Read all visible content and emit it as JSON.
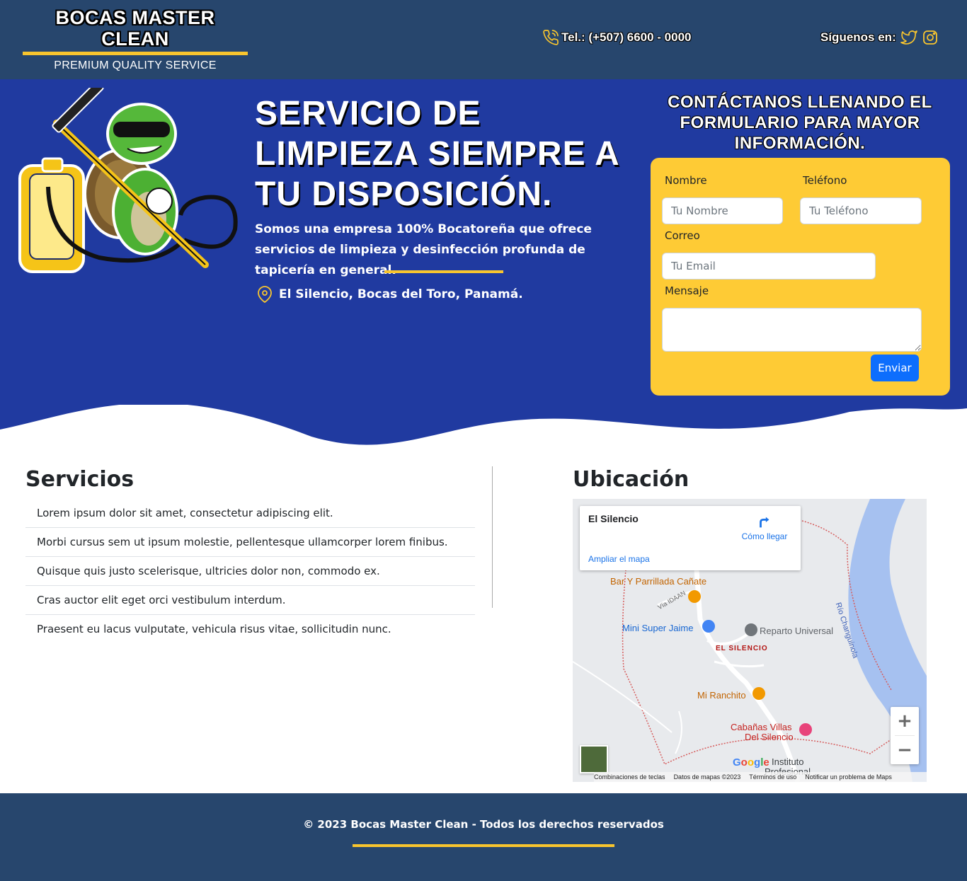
{
  "header": {
    "logo_title": "BOCAS MASTER CLEAN",
    "logo_subtitle": "PREMIUM QUALITY SERVICE",
    "phone": "Tel.: (+507) 6600 - 0000",
    "social_label": "Síguenos en:",
    "social_icons": [
      "twitter-icon",
      "instagram-icon"
    ],
    "accent_color": "#f8c52e",
    "bg_color": "#27466d"
  },
  "hero": {
    "title": "SERVICIO DE LIMPIEZA SIEMPRE A TU DISPOSICIÓN.",
    "description": "Somos una empresa 100% Bocatoreña que ofrece servicios de limpieza y desinfección profunda de tapicería en general.",
    "location": "El Silencio, Bocas del Toro, Panamá.",
    "bg_color": "#203aa0"
  },
  "contact_form": {
    "title": "CONTÁCTANOS LLENANDO EL FORMULARIO PARA MAYOR INFORMACIÓN.",
    "name_label": "Nombre",
    "name_placeholder": "Tu Nombre",
    "phone_label": "Teléfono",
    "phone_placeholder": "Tu Teléfono",
    "email_label": "Correo",
    "email_placeholder": "Tu Email",
    "message_label": "Mensaje",
    "submit_label": "Enviar",
    "card_color": "#fecb35"
  },
  "services": {
    "title": "Servicios",
    "items": [
      "Lorem ipsum dolor sit amet, consectetur adipiscing elit.",
      "Morbi cursus sem ut ipsum molestie, pellentesque ullamcorper lorem finibus.",
      "Quisque quis justo scelerisque, ultricies dolor non, commodo ex.",
      "Cras auctor elit eget orci vestibulum interdum.",
      "Praesent eu lacus vulputate, vehicula risus vitae, sollicitudin nunc."
    ]
  },
  "location_section": {
    "title": "Ubicación",
    "map": {
      "place_name": "El Silencio",
      "directions_label": "Cómo llegar",
      "enlarge_label": "Ampliar el mapa",
      "labels": {
        "bar": "Bar Y Parrillada Cañate",
        "road": "Vía IDAAN",
        "market": "Mini Super Jaime",
        "reparto": "Reparto Universal",
        "town": "EL SILENCIO",
        "ranchito": "Mi Ranchito",
        "cabanas_1": "Cabañas Villas",
        "cabanas_2": "Del Silencio",
        "river": "Río Changuinola",
        "instituto_1": "Instituto",
        "instituto_2": "Profesional"
      },
      "google": "Google",
      "zoom_in": "+",
      "zoom_out": "−",
      "footer": [
        "Combinaciones de teclas",
        "Datos de mapas ©2023",
        "Términos de uso",
        "Notificar un problema de Maps"
      ]
    }
  },
  "footer": {
    "text": "© 2023 Bocas Master Clean - Todos los derechos reservados"
  }
}
